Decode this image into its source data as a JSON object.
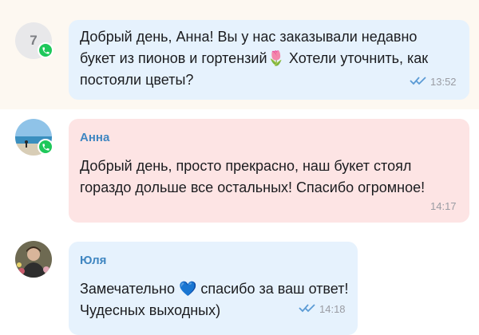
{
  "messages": [
    {
      "avatar_label": "7",
      "text_line1": "Добрый день, Анна! Вы у нас заказывали недавно",
      "text_line2": "букет из пионов и гортензий🌷 Хотели уточнить, как",
      "text_line3": "постояли цветы?",
      "time": "13:52",
      "read_icon": "double-check-icon"
    },
    {
      "sender": "Анна",
      "text_line1": "Добрый день, просто прекрасно, наш букет стоял",
      "text_line2": "гораздо дольше все остальных! Спасибо огромное!",
      "time": "14:17"
    },
    {
      "sender": "Юля",
      "text_line1": "Замечательно 💙 спасибо за ваш ответ!",
      "text_line2": "Чудесных выходных)",
      "time": "14:18",
      "read_icon": "double-check-icon"
    }
  ],
  "colors": {
    "whatsapp_badge": "#1ec85a",
    "bubble_outgoing": "#e6f2fd",
    "bubble_incoming": "#fde4e4",
    "sender_name": "#3f86c1",
    "read_checks": "#5b9bd5"
  }
}
